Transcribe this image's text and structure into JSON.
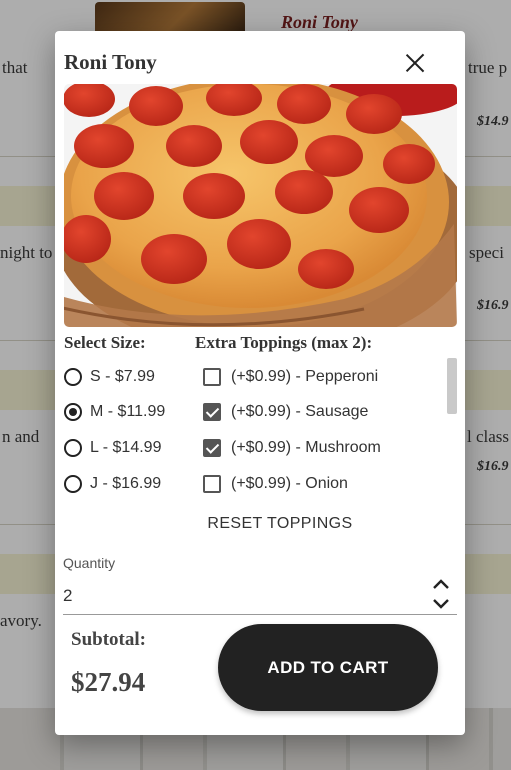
{
  "background": {
    "heading": "Roni Tony",
    "snippets": {
      "left_1": "that",
      "right_1": "true p",
      "price_1": "$14.9",
      "left_2": "night to",
      "right_2": "speci",
      "price_2": "$16.9",
      "left_3": "n and",
      "right_3": "l class",
      "price_3": "$16.9",
      "left_4": "avory."
    }
  },
  "modal": {
    "title": "Roni Tony",
    "size_label": "Select Size:",
    "toppings_label": "Extra Toppings (max 2):",
    "sizes": [
      {
        "label": "S - $7.99",
        "selected": false
      },
      {
        "label": "M - $11.99",
        "selected": true
      },
      {
        "label": "L - $14.99",
        "selected": false
      },
      {
        "label": "J - $16.99",
        "selected": false
      }
    ],
    "toppings": [
      {
        "label": "(+$0.99) - Pepperoni",
        "checked": false
      },
      {
        "label": "(+$0.99) - Sausage",
        "checked": true
      },
      {
        "label": "(+$0.99) - Mushroom",
        "checked": true
      },
      {
        "label": "(+$0.99) - Onion",
        "checked": false
      }
    ],
    "reset_label": "RESET TOPPINGS",
    "quantity_label": "Quantity",
    "quantity_value": "2",
    "subtotal_label": "Subtotal:",
    "subtotal_value": "$27.94",
    "add_to_cart_label": "ADD TO CART"
  },
  "icons": {
    "close": "close-icon",
    "increment": "chevron-up-icon",
    "decrement": "chevron-down-icon"
  },
  "colors": {
    "button_bg": "#222222",
    "band": "#f6f3d5",
    "heading": "#7a1f1f"
  }
}
